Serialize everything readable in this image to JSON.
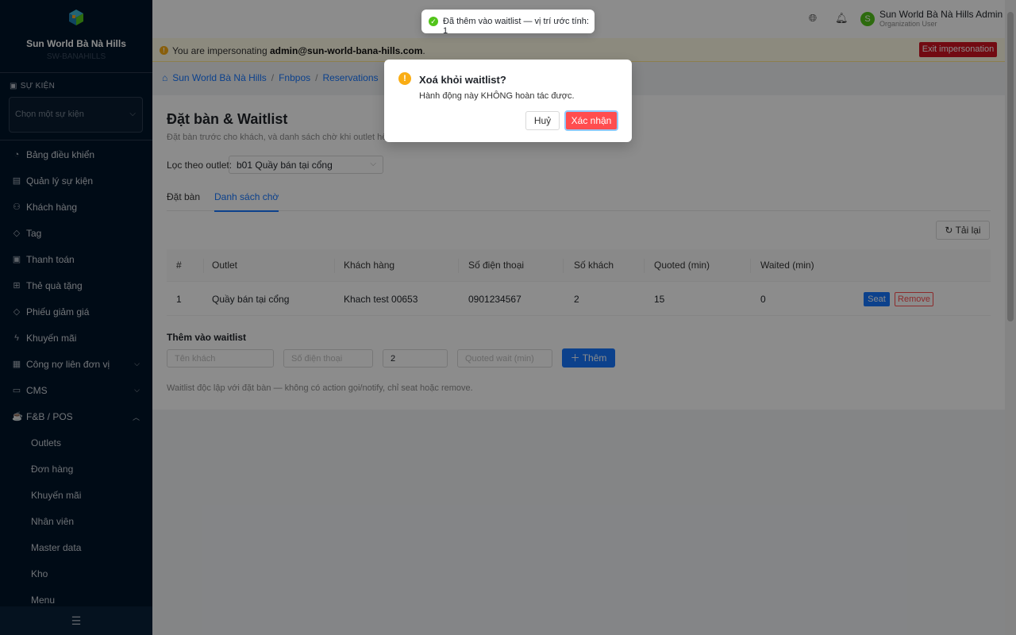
{
  "brand": {
    "name": "Sun World Bà Nà Hills",
    "sub": "SW-BANAHILLS"
  },
  "sidebar": {
    "event_label": "SỰ KIỆN",
    "event_placeholder": "Chọn một sự kiện",
    "items": [
      {
        "label": "Bảng điều khiển",
        "icon": "dashboard-icon"
      },
      {
        "label": "Quản lý sự kiện",
        "icon": "calendar-icon"
      },
      {
        "label": "Khách hàng",
        "icon": "users-icon"
      },
      {
        "label": "Tag",
        "icon": "tag-icon"
      },
      {
        "label": "Thanh toán",
        "icon": "payment-icon"
      },
      {
        "label": "Thẻ quà tặng",
        "icon": "gift-icon"
      },
      {
        "label": "Phiếu giảm giá",
        "icon": "coupon-icon"
      },
      {
        "label": "Khuyến mãi",
        "icon": "promotion-icon"
      },
      {
        "label": "Công nợ liên đơn vị",
        "icon": "debt-icon"
      },
      {
        "label": "CMS",
        "icon": "cms-icon"
      },
      {
        "label": "F&B / POS",
        "icon": "fnb-icon"
      }
    ],
    "sub_items": [
      "Outlets",
      "Đơn hàng",
      "Khuyến mãi",
      "Nhân viên",
      "Master data",
      "Kho",
      "Menu"
    ]
  },
  "header": {
    "user_initial": "S",
    "user_name": "Sun World Bà Nà Hills Admin",
    "user_role": "Organization User"
  },
  "banner": {
    "prefix": "You are impersonating ",
    "email": "admin@sun-world-bana-hills.com",
    "suffix": ".",
    "exit_label": "Exit impersonation"
  },
  "breadcrumb": [
    "Sun World Bà Nà Hills",
    "Fnbpos",
    "Reservations"
  ],
  "page": {
    "title": "Đặt bàn & Waitlist",
    "subtitle": "Đặt bàn trước cho khách, và danh sách chờ khi outlet hết bàn.",
    "filter_label": "Lọc theo outlet:",
    "filter_value": "b01 Quầy bán tại cổng",
    "tabs": [
      "Đặt bàn",
      "Danh sách chờ"
    ],
    "reload_label": "Tải lại"
  },
  "table": {
    "columns": [
      "#",
      "Outlet",
      "Khách hàng",
      "Số điện thoại",
      "Số khách",
      "Quoted (min)",
      "Waited (min)"
    ],
    "rows": [
      {
        "idx": "1",
        "outlet": "Quầy bán tại cổng",
        "customer": "Khach test 00653",
        "phone": "0901234567",
        "guests": "2",
        "quoted": "15",
        "waited": "0"
      }
    ],
    "seat_label": "Seat",
    "remove_label": "Remove"
  },
  "add_form": {
    "title": "Thêm vào waitlist",
    "name_placeholder": "Tên khách",
    "phone_placeholder": "Số điện thoại",
    "guests_value": "2",
    "quoted_placeholder": "Quoted wait (min)",
    "add_label": "Thêm",
    "note": "Waitlist độc lập với đặt bàn — không có action gọi/notify, chỉ seat hoặc remove."
  },
  "toast": {
    "text": "Đã thêm vào waitlist — vị trí ước tính: 1"
  },
  "modal": {
    "title": "Xoá khỏi waitlist?",
    "body": "Hành động này KHÔNG hoàn tác được.",
    "cancel_label": "Huỷ",
    "confirm_label": "Xác nhận"
  },
  "colors": {
    "primary": "#1677ff",
    "danger": "#ff4d4f",
    "warning": "#faad14",
    "success": "#52c41a",
    "sidebar_bg": "#001529"
  }
}
